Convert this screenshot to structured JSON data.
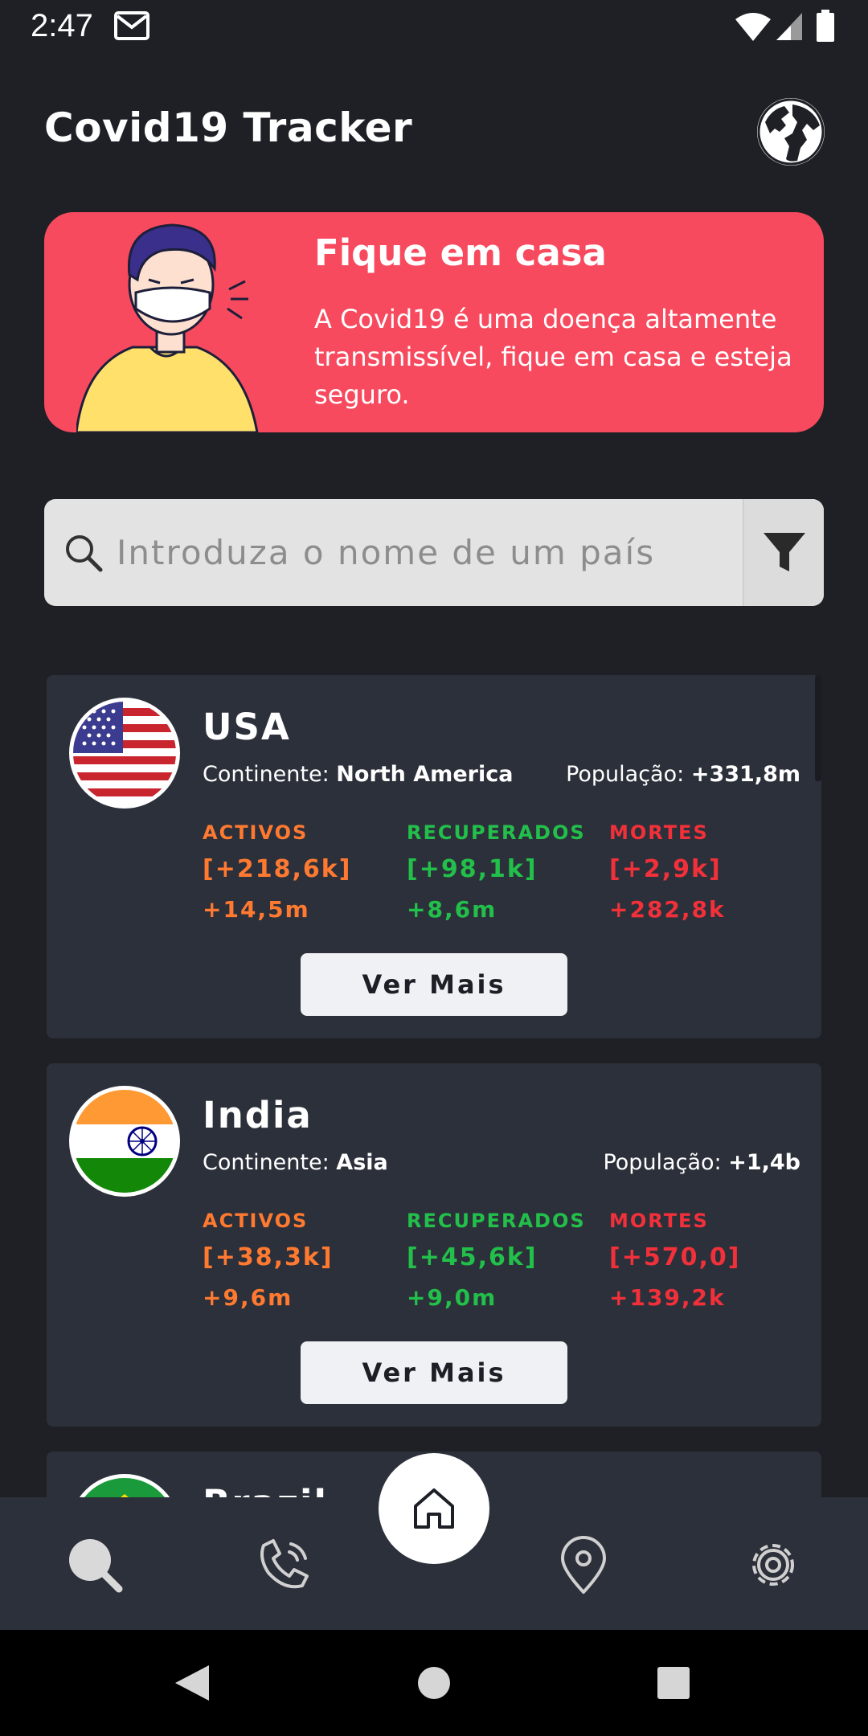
{
  "status_bar": {
    "time": "2:47",
    "icons": [
      "gmail-icon",
      "wifi-icon",
      "signal-icon",
      "battery-icon"
    ]
  },
  "header": {
    "title": "Covid19 Tracker",
    "globe_icon": "globe-icon"
  },
  "banner": {
    "title": "Fique em casa",
    "text": "A Covid19 é uma doença altamente transmissível, fique em casa e esteja seguro.",
    "background_color": "#f74a5e"
  },
  "search": {
    "placeholder": "Introduza o nome de um país",
    "value": "",
    "icon": "search-icon",
    "filter_icon": "filter-icon"
  },
  "labels": {
    "continent": "Continente:",
    "population": "População:",
    "active": "ACTIVOS",
    "recovered": "RECUPERADOS",
    "deaths": "MORTES",
    "more_button": "Ver Mais"
  },
  "colors": {
    "active": "#ff7a30",
    "recovered": "#22c04a",
    "deaths": "#f2303a",
    "card_bg": "#2c303a"
  },
  "countries": [
    {
      "name": "USA",
      "continent": "North America",
      "population": "+331,8m",
      "active_today": "[+218,6k]",
      "active_total": "+14,5m",
      "recovered_today": "[+98,1k]",
      "recovered_total": "+8,6m",
      "deaths_today": "[+2,9k]",
      "deaths_total": "+282,8k",
      "flag_icon": "usa-flag-icon"
    },
    {
      "name": "India",
      "continent": "Asia",
      "population": "+1,4b",
      "active_today": "[+38,3k]",
      "active_total": "+9,6m",
      "recovered_today": "[+45,6k]",
      "recovered_total": "+9,0m",
      "deaths_today": "[+570,0]",
      "deaths_total": "+139,2k",
      "flag_icon": "india-flag-icon"
    },
    {
      "name": "Brazil",
      "flag_icon": "brazil-flag-icon"
    }
  ],
  "bottom_nav": {
    "items": [
      "search-icon",
      "phone-icon",
      "home-icon",
      "location-icon",
      "settings-icon"
    ]
  },
  "system_nav": {
    "items": [
      "back-icon",
      "home-circle-icon",
      "recents-icon"
    ]
  }
}
